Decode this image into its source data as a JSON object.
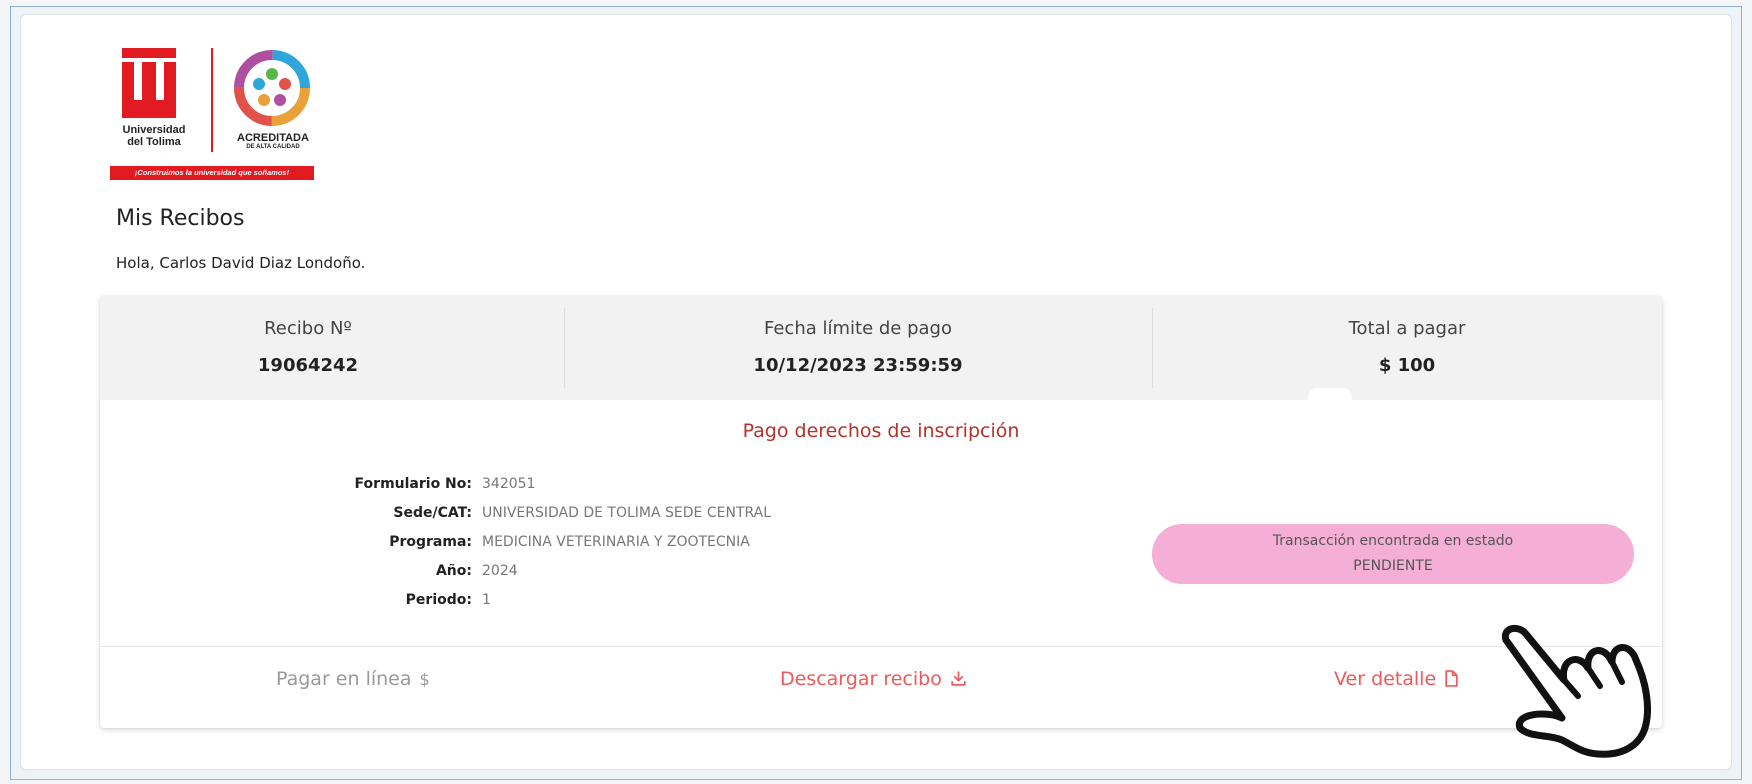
{
  "logo": {
    "name_line1": "Universidad",
    "name_line2": "del Tolima",
    "accreditation": "ACREDITADA",
    "accreditation_sub": "DE ALTA CALIDAD",
    "slogan": "¡Construimos la universidad que soñamos!",
    "brand_color": "#e21b23"
  },
  "page": {
    "title": "Mis Recibos",
    "greeting": "Hola, Carlos David Diaz Londoño."
  },
  "receipt": {
    "number_label": "Recibo Nº",
    "number": "19064242",
    "due_label": "Fecha límite de pago",
    "due_date": "10/12/2023 23:59:59",
    "total_label": "Total a pagar",
    "total": "$ 100",
    "concept": "Pago derechos de inscripción",
    "details": [
      {
        "label": "Formulario No:",
        "value": "342051"
      },
      {
        "label": "Sede/CAT:",
        "value": "UNIVERSIDAD DE TOLIMA SEDE CENTRAL"
      },
      {
        "label": "Programa:",
        "value": "MEDICINA VETERINARIA Y ZOOTECNIA"
      },
      {
        "label": "Año:",
        "value": "2024"
      },
      {
        "label": "Periodo:",
        "value": "1"
      }
    ],
    "status_line1": "Transacción encontrada en estado",
    "status_line2": "PENDIENTE",
    "status_color": "#f5aed6"
  },
  "actions": {
    "pay_online": "Pagar en línea",
    "pay_icon": "dollar-icon",
    "download": "Descargar recibo",
    "download_icon": "download-icon",
    "detail": "Ver detalle",
    "detail_icon": "document-icon",
    "accent_color": "#ee5a5a"
  }
}
